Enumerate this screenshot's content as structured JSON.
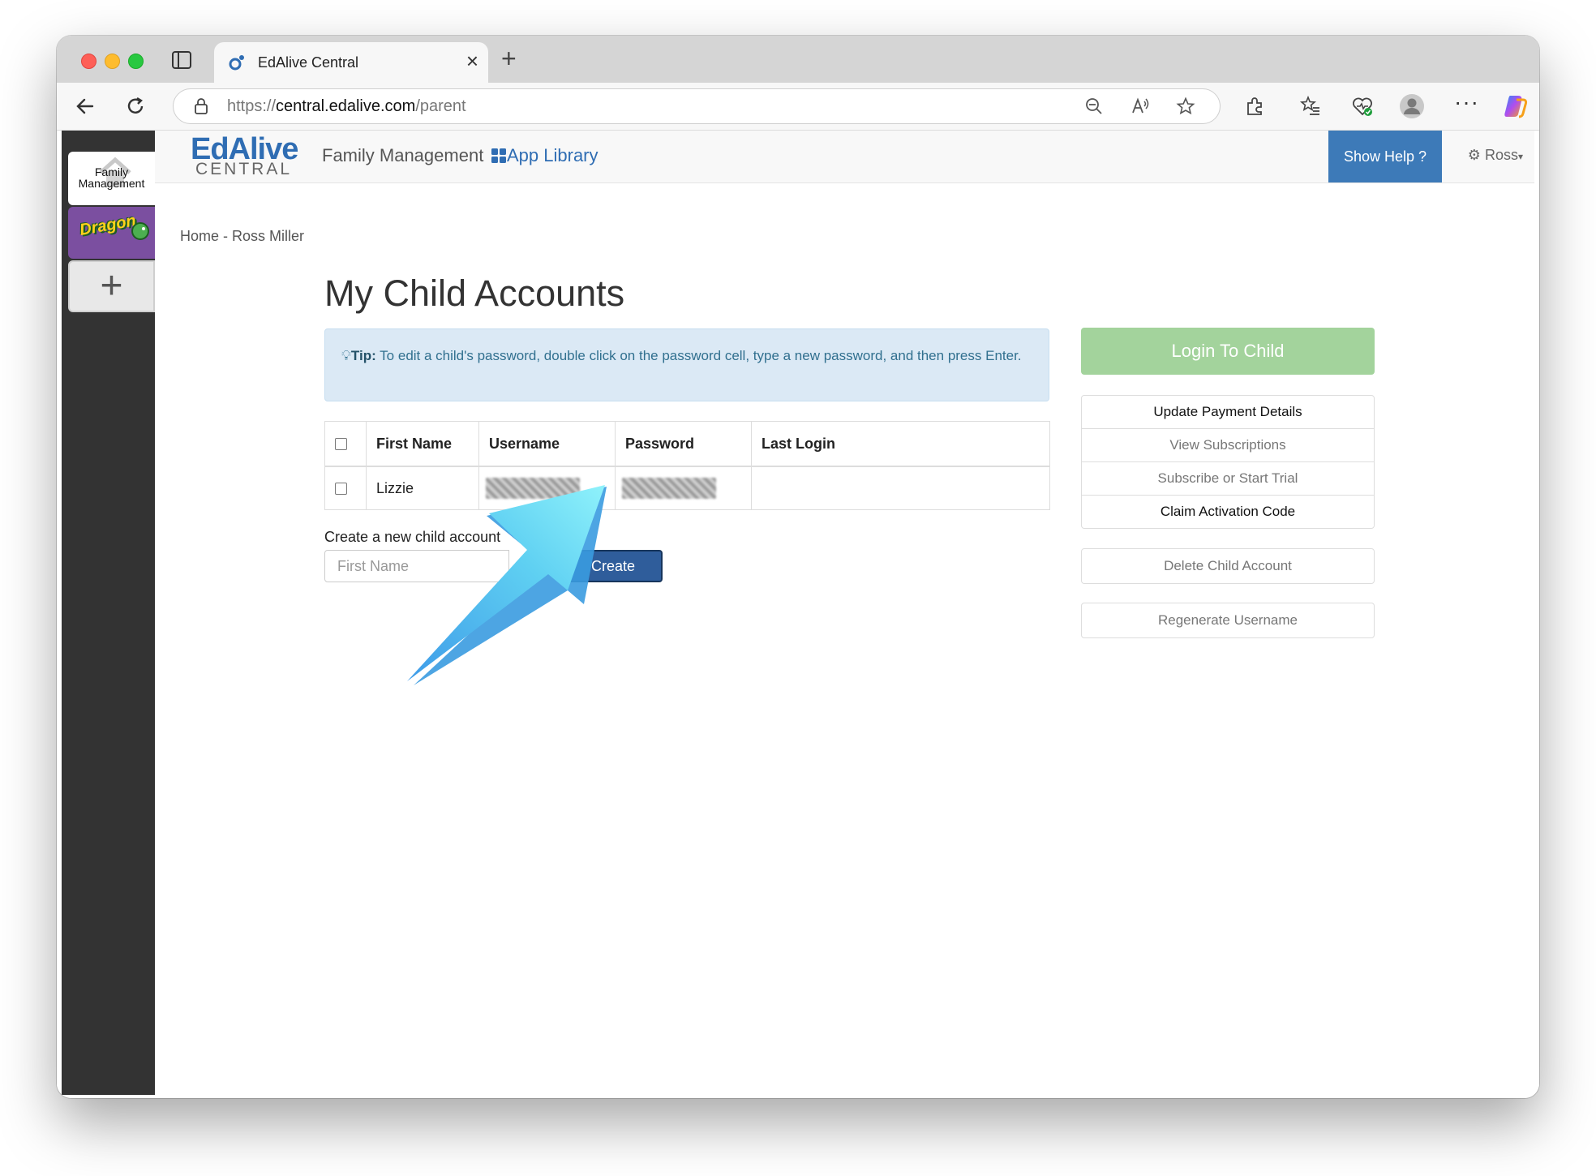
{
  "browser": {
    "tab_title": "EdAlive Central",
    "url_prefix": "https://",
    "url_host": "central.edalive.com",
    "url_path": "/parent"
  },
  "sidebar": {
    "family_label_line1": "Family",
    "family_label_line2": "Management",
    "dragon_label": "Dragon",
    "add_label": "+"
  },
  "nav": {
    "brand_ed": "EdAlive",
    "brand_central": "CENTRAL",
    "family_management": "Family Management",
    "app_library": "App Library",
    "show_help": "Show Help ?",
    "user": "Ross"
  },
  "breadcrumb": "Home - Ross Miller",
  "page_title": "My Child Accounts",
  "tip": {
    "label": "Tip:",
    "text": " To edit a child's password, double click on the password cell, type a new password, and then press Enter."
  },
  "table": {
    "headers": [
      "First Name",
      "Username",
      "Password",
      "Last Login"
    ],
    "rows": [
      {
        "first_name": "Lizzie",
        "username": "",
        "password": "",
        "last_login": ""
      }
    ]
  },
  "create": {
    "label": "Create a new child account",
    "placeholder": "First Name",
    "button": "Create"
  },
  "actions": {
    "login_to_child": "Login To Child",
    "update_payment": "Update Payment Details",
    "view_subscriptions": "View Subscriptions",
    "subscribe_trial": "Subscribe or Start Trial",
    "claim_code": "Claim Activation Code",
    "delete_child": "Delete Child Account",
    "regenerate_username": "Regenerate Username"
  },
  "colors": {
    "brand_blue": "#2f6db3",
    "help_blue": "#3d7ab8",
    "login_green": "#a3d39c",
    "create_blue": "#2f5d9b",
    "tip_bg": "#dbe9f5",
    "arrow_cyan": "#6fe6f7"
  }
}
